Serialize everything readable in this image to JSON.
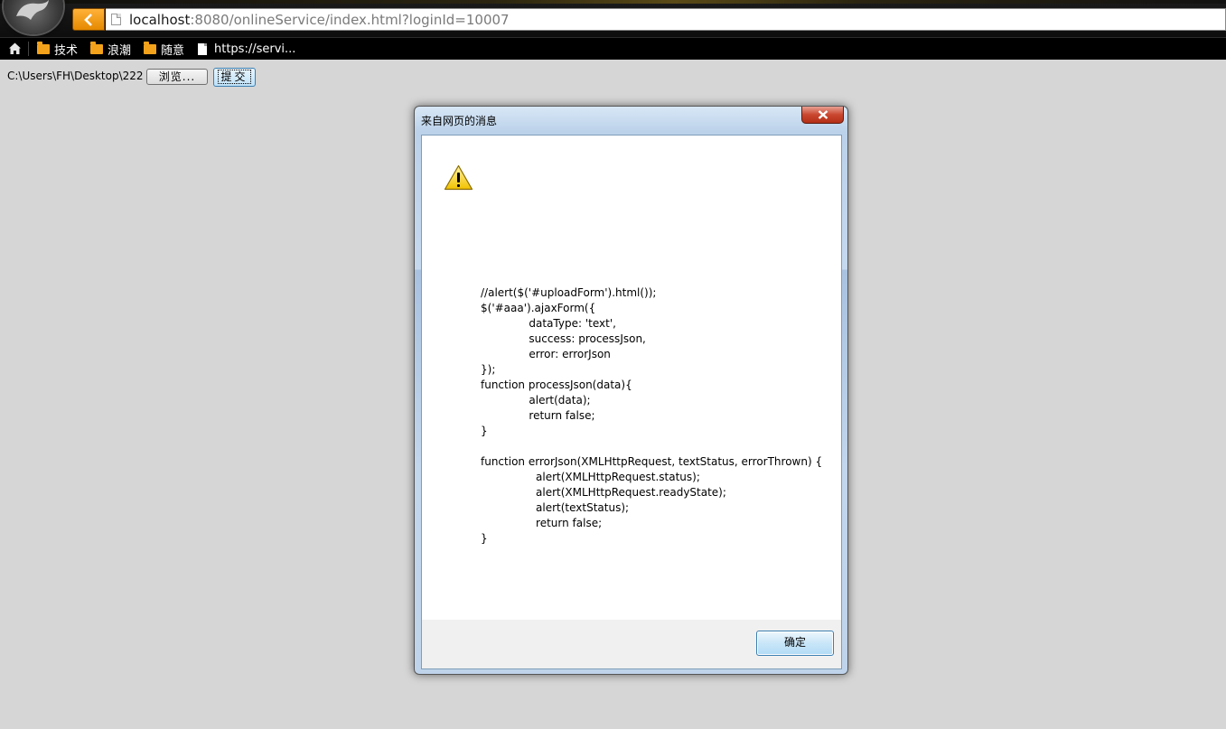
{
  "browser": {
    "url_host": "localhost",
    "url_rest": ":8080/onlineService/index.html?loginId=10007",
    "bookmarks": [
      {
        "label": "技术",
        "type": "folder"
      },
      {
        "label": "浪潮",
        "type": "folder"
      },
      {
        "label": "随意",
        "type": "folder"
      },
      {
        "label": "https://servi...",
        "type": "page"
      }
    ]
  },
  "form": {
    "file_path": "C:\\Users\\FH\\Desktop\\222",
    "browse_label": "浏览...",
    "submit_label": "提交"
  },
  "dialog": {
    "title": "来自网页的消息",
    "message": "//alert($('#uploadForm').html());\n$('#aaa').ajaxForm({\n              dataType: 'text',\n              success: processJson,\n              error: errorJson\n});\nfunction processJson(data){\n              alert(data);\n              return false;\n}\n\nfunction errorJson(XMLHttpRequest, textStatus, errorThrown) {\n                alert(XMLHttpRequest.status);\n                alert(XMLHttpRequest.readyState);\n                alert(textStatus);\n                return false;\n}",
    "ok_label": "确定",
    "icon": "warning-icon"
  }
}
